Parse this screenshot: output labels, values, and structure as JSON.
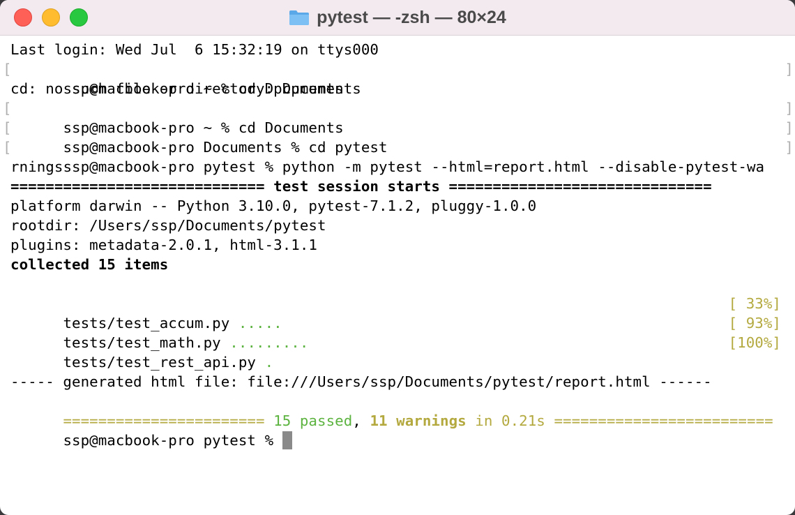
{
  "window": {
    "title": "pytest — -zsh — 80×24",
    "colors": {
      "close": "#fe5f57",
      "minimize": "#febc2e",
      "zoom": "#28c840"
    }
  },
  "terminal": {
    "lines": {
      "l1": "Last login: Wed Jul  6 15:32:19 on ttys000",
      "l2": "ssp@macbook-pro ~ % cd Dpcuments",
      "l3": "cd: no such file or directory: Dpcuments",
      "l4": "ssp@macbook-pro ~ % cd Documents",
      "l5": "ssp@macbook-pro Documents % cd pytest",
      "l6": "ssp@macbook-pro pytest % python -m pytest --html=report.html --disable-pytest-wa",
      "l7": "rnings",
      "l8": "============================= test session starts ==============================",
      "l9": "platform darwin -- Python 3.10.0, pytest-7.1.2, pluggy-1.0.0",
      "l10": "rootdir: /Users/ssp/Documents/pytest",
      "l11": "plugins: metadata-2.0.1, html-3.1.1",
      "l12": "collected 15 items",
      "l17": "----- generated html file: file:///Users/ssp/Documents/pytest/report.html ------"
    },
    "tests": [
      {
        "file": "tests/test_accum.py ",
        "dots": ".....",
        "percent": "[ 33%]"
      },
      {
        "file": "tests/test_math.py ",
        "dots": ".........",
        "percent": "[ 93%]"
      },
      {
        "file": "tests/test_rest_api.py ",
        "dots": ".",
        "percent": "[100%]"
      }
    ],
    "summary": {
      "prefix": "======================= ",
      "passed": "15 passed",
      "comma": ", ",
      "warnings": "11 warnings",
      "time": " in 0.21s ",
      "suffix": "========================="
    },
    "prompt": "ssp@macbook-pro pytest % ",
    "bracket_open": "[",
    "bracket_close": "]",
    "colors": {
      "pass": "#5cb33f",
      "warn": "#b3a93f",
      "cursor": "#8a8a8a"
    }
  }
}
